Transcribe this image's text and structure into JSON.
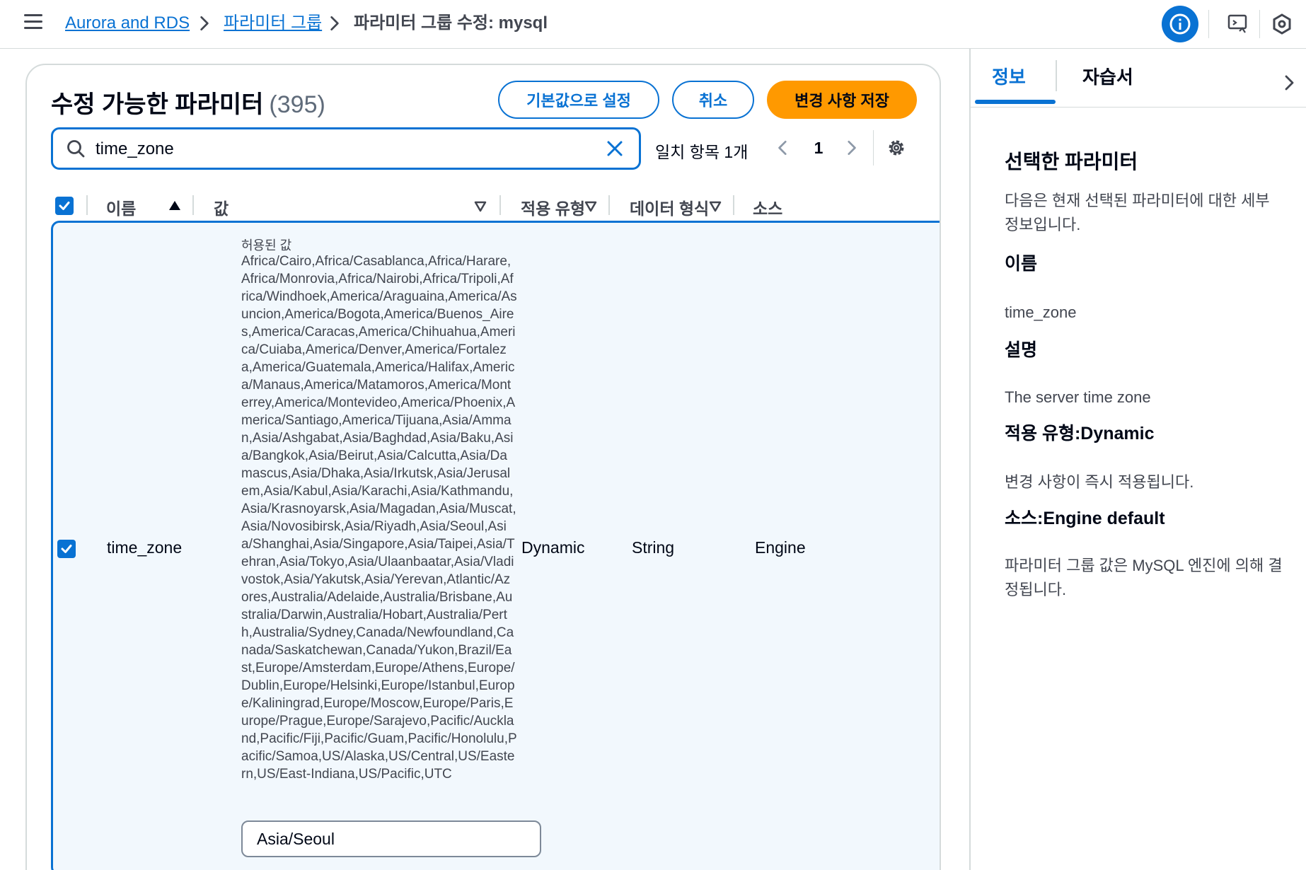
{
  "breadcrumb": {
    "items": [
      "Aurora and RDS",
      "파라미터 그룹"
    ],
    "current": "파라미터 그룹 수정: mysql"
  },
  "panel": {
    "title": "수정 가능한 파라미터",
    "count": "(395)",
    "reset_label": "기본값으로 설정",
    "cancel_label": "취소",
    "save_label": "변경 사항 저장"
  },
  "search": {
    "value": "time_zone"
  },
  "pagination": {
    "match_text": "일치 항목 1개",
    "page": "1"
  },
  "table": {
    "columns": {
      "name": "이름",
      "value": "값",
      "apply_type": "적용 유형",
      "data_type": "데이터 형식",
      "source": "소스"
    },
    "row": {
      "name": "time_zone",
      "allowed_label": "허용된 값",
      "allowed_values": "Africa/Cairo,Africa/Casablanca,Africa/Harare,Africa/Monrovia,Africa/Nairobi,Africa/Tripoli,Africa/Windhoek,America/Araguaina,America/Asuncion,America/Bogota,America/Buenos_Aires,America/Caracas,America/Chihuahua,America/Cuiaba,America/Denver,America/Fortaleza,America/Guatemala,America/Halifax,America/Manaus,America/Matamoros,America/Monterrey,America/Montevideo,America/Phoenix,America/Santiago,America/Tijuana,Asia/Amman,Asia/Ashgabat,Asia/Baghdad,Asia/Baku,Asia/Bangkok,Asia/Beirut,Asia/Calcutta,Asia/Damascus,Asia/Dhaka,Asia/Irkutsk,Asia/Jerusalem,Asia/Kabul,Asia/Karachi,Asia/Kathmandu,Asia/Krasnoyarsk,Asia/Magadan,Asia/Muscat,Asia/Novosibirsk,Asia/Riyadh,Asia/Seoul,Asia/Shanghai,Asia/Singapore,Asia/Taipei,Asia/Tehran,Asia/Tokyo,Asia/Ulaanbaatar,Asia/Vladivostok,Asia/Yakutsk,Asia/Yerevan,Atlantic/Azores,Australia/Adelaide,Australia/Brisbane,Australia/Darwin,Australia/Hobart,Australia/Perth,Australia/Sydney,Canada/Newfoundland,Canada/Saskatchewan,Canada/Yukon,Brazil/East,Europe/Amsterdam,Europe/Athens,Europe/Dublin,Europe/Helsinki,Europe/Istanbul,Europe/Kaliningrad,Europe/Moscow,Europe/Paris,Europe/Prague,Europe/Sarajevo,Pacific/Auckland,Pacific/Fiji,Pacific/Guam,Pacific/Honolulu,Pacific/Samoa,US/Alaska,US/Central,US/Eastern,US/East-Indiana,US/Pacific,UTC",
      "value": "Asia/Seoul",
      "apply_type": "Dynamic",
      "data_type": "String",
      "source": "Engine"
    }
  },
  "side": {
    "tab_info": "정보",
    "tab_tutorial": "자습서",
    "heading": "선택한 파라미터",
    "intro": "다음은 현재 선택된 파라미터에 대한 세부 정보입니다.",
    "name_label": "이름",
    "name_value": "time_zone",
    "desc_label": "설명",
    "desc_value": "The server time zone",
    "apply_label": "적용 유형:Dynamic",
    "apply_value": "변경 사항이 즉시 적용됩니다.",
    "source_label": "소스:Engine default",
    "source_value": "파라미터 그룹 값은 MySQL 엔진에 의해 결정됩니다."
  },
  "colors": {
    "accent": "#0972d3",
    "primary_button": "#ff9900",
    "selected_row_bg": "#f2f8fd"
  }
}
